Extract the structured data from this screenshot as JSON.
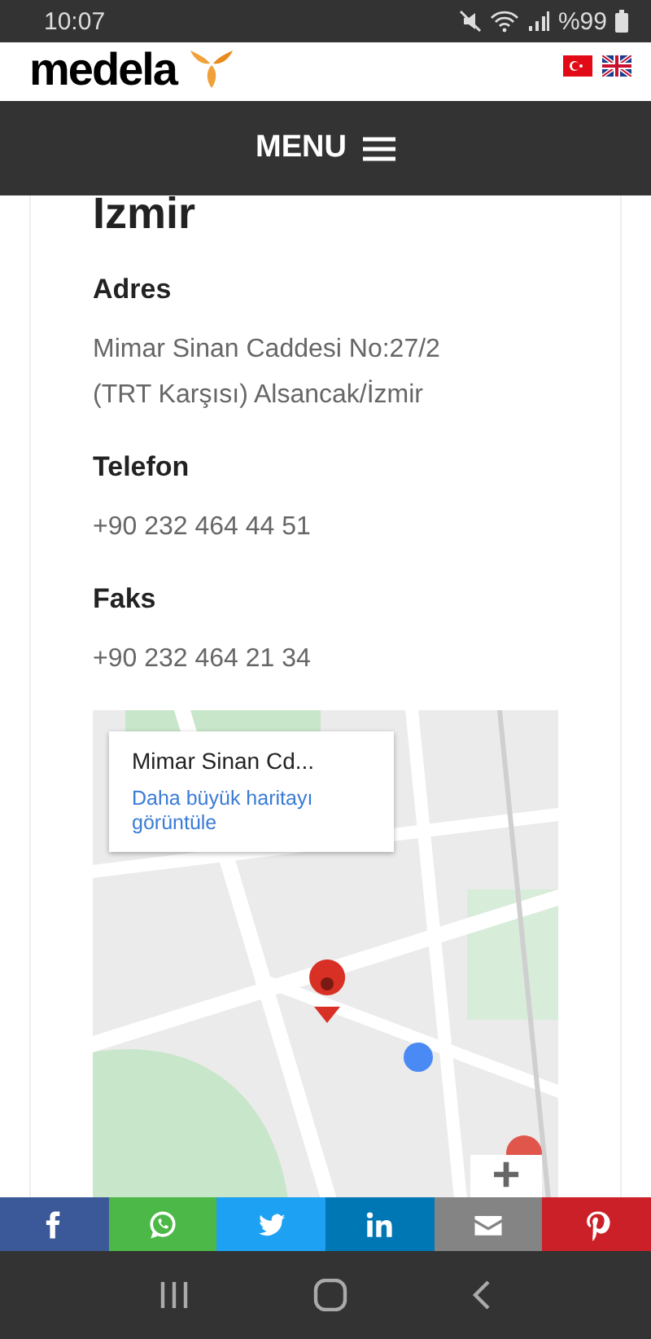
{
  "status_bar": {
    "time": "10:07",
    "battery": "%99"
  },
  "header": {
    "logo": "medela",
    "languages": [
      {
        "kind": "turkish"
      },
      {
        "kind": "english"
      }
    ]
  },
  "menu": {
    "label": "MENU"
  },
  "contact": {
    "city": "Izmir",
    "fields": [
      {
        "label": "Adres",
        "lines": [
          "Mimar Sinan Caddesi No:27/2",
          "(TRT Karşısı) Alsancak/İzmir"
        ]
      },
      {
        "label": "Telefon",
        "lines": [
          "+90 232 464 44 51"
        ]
      },
      {
        "label": "Faks",
        "lines": [
          "+90 232 464 21 34"
        ]
      }
    ]
  },
  "map": {
    "kind": "picture",
    "info": {
      "title": "Mimar Sinan Cd...",
      "link": "Daha büyük haritayı görüntüle"
    },
    "zoom": "+"
  },
  "share": [
    {
      "kind": "facebook",
      "color": "#3b5998"
    },
    {
      "kind": "whatsapp",
      "color": "#4cb848"
    },
    {
      "kind": "twitter",
      "color": "#1da1f2"
    },
    {
      "kind": "linkedin",
      "color": "#0077b5"
    },
    {
      "kind": "email",
      "color": "#848484"
    },
    {
      "kind": "pinterest",
      "color": "#cb2027"
    }
  ]
}
